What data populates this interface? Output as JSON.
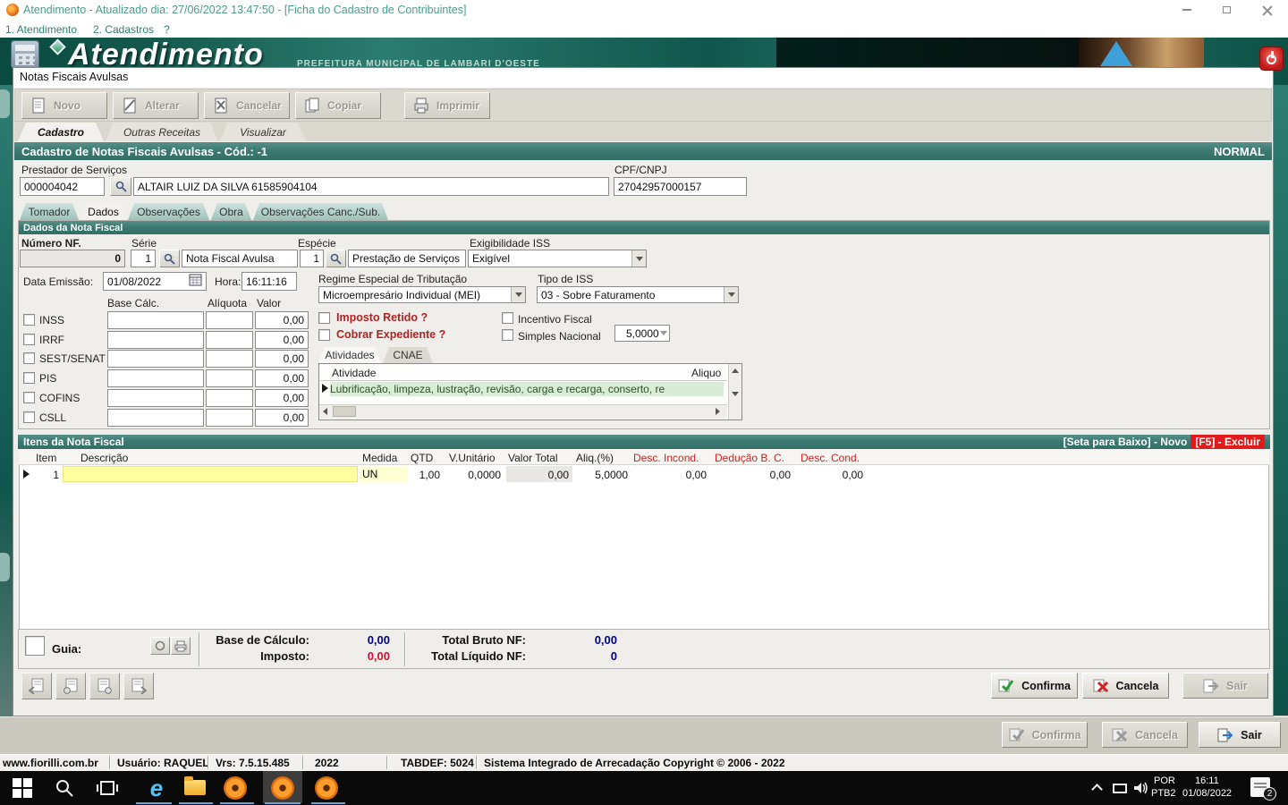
{
  "window": {
    "title": "Atendimento - Atualizado dia: 27/06/2022 13:47:50 - [Ficha do Cadastro de Contribuintes]",
    "menu": [
      "1. Atendimento",
      "2. Cadastros",
      "?"
    ]
  },
  "banner": {
    "app": "Atendimento",
    "subtitle": "PREFEITURA MUNICIPAL DE LAMBARI D'OESTE"
  },
  "dialog": {
    "title": "Notas Fiscais Avulsas",
    "toolbar": {
      "novo": "Novo",
      "alterar": "Alterar",
      "cancelar": "Cancelar",
      "copiar": "Copiar",
      "imprimir": "Imprimir"
    },
    "tabs": {
      "cadastro": "Cadastro",
      "outras": "Outras Receitas",
      "visualizar": "Visualizar"
    },
    "header": {
      "title": "Cadastro de Notas Fiscais Avulsas - Cód.: -1",
      "status": "NORMAL"
    },
    "prestador": {
      "label": "Prestador de Serviços",
      "code": "000004042",
      "name": "ALTAIR LUIZ DA SILVA 61585904104",
      "cpf_label": "CPF/CNPJ",
      "cpf": "27042957000157"
    },
    "inner_tabs": {
      "tomador": "Tomador",
      "dados": "Dados",
      "observacoes": "Observações",
      "obra": "Obra",
      "obs_canc": "Observações Canc./Sub."
    },
    "dados": {
      "section": "Dados da Nota Fiscal",
      "labels": {
        "numero": "Número NF.",
        "serie": "Série",
        "especie": "Espécie",
        "exigibilidade": "Exigibilidade ISS",
        "data": "Data Emissão:",
        "hora": "Hora:",
        "regime": "Regime Especial de Tributação",
        "tipo_iss": "Tipo de ISS",
        "base": "Base Cálc.",
        "aliquota": "Alíquota",
        "valor": "Valor"
      },
      "values": {
        "numero": "0",
        "serie": "1",
        "serie_desc": "Nota Fiscal Avulsa",
        "especie": "1",
        "especie_desc": "Prestação de Serviços",
        "exigibilidade": "Exigível",
        "data": "01/08/2022",
        "hora": "16:11:16",
        "regime": "Microempresário Individual (MEI)",
        "tipo_iss": "03 - Sobre Faturamento"
      },
      "taxes": [
        {
          "label": "INSS",
          "valor": "0,00"
        },
        {
          "label": "IRRF",
          "valor": "0,00"
        },
        {
          "label": "SEST/SENAT",
          "valor": "0,00"
        },
        {
          "label": "PIS",
          "valor": "0,00"
        },
        {
          "label": "COFINS",
          "valor": "0,00"
        },
        {
          "label": "CSLL",
          "valor": "0,00"
        }
      ],
      "flags": {
        "imposto_retido": "Imposto Retido ?",
        "cobrar_expediente": "Cobrar Expediente ?",
        "incentivo": "Incentivo Fiscal",
        "simples": "Simples Nacional",
        "simples_valor": "5,0000"
      },
      "atividades": {
        "tab_atividades": "Atividades",
        "tab_cnae": "CNAE",
        "col_atividade": "Atividade",
        "col_aliquota": "Aliquo",
        "row": "Lubrificação, limpeza, lustração, revisão, carga e recarga, conserto, re"
      }
    },
    "itens": {
      "section": "Itens da Nota Fiscal",
      "hint": "[Seta para Baixo] - Novo",
      "hint_red": "[F5] - Excluir",
      "columns": [
        "Item",
        "Descrição",
        "Medida",
        "QTD",
        "V.Unitário",
        "Valor Total",
        "Aliq.(%)",
        "Desc. Incond.",
        "Dedução B. C.",
        "Desc. Cond."
      ],
      "row": {
        "item": "1",
        "descricao": "",
        "medida": "UN",
        "qtd": "1,00",
        "v_unitario": "0,0000",
        "valor_total": "0,00",
        "aliq": "5,0000",
        "desc_incond": "0,00",
        "deducao": "0,00",
        "desc_cond": "0,00"
      }
    },
    "totais": {
      "guia": "Guia:",
      "base_label": "Base de Cálculo:",
      "base": "0,00",
      "imposto_label": "Imposto:",
      "imposto": "0,00",
      "bruto_label": "Total Bruto NF:",
      "bruto": "0,00",
      "liquido_label": "Total Líquido NF:",
      "liquido": "0"
    },
    "buttons": {
      "confirma": "Confirma",
      "cancela": "Cancela",
      "sair": "Sair"
    }
  },
  "outer_buttons": {
    "confirma": "Confirma",
    "cancela": "Cancela",
    "sair": "Sair"
  },
  "status_bar": [
    "www.fiorilli.com.br",
    "Usuário: RAQUEL",
    "Vrs: 7.5.15.485",
    "2022",
    "TABDEF: 5024",
    "Sistema Integrado de Arrecadação Copyright © 2006 - 2022"
  ],
  "taskbar": {
    "ie_letter": "e",
    "lang1": "POR",
    "lang2": "PTB2",
    "time": "16:11",
    "date": "01/08/2022",
    "badge": "2"
  },
  "colors": {
    "teal_header": "#3c7a72",
    "accent_red": "#cc2222",
    "value_blue": "#000080",
    "value_red": "#d01030",
    "row_yellow": "#ffffa0",
    "activity_green": "#d9ecd5"
  }
}
